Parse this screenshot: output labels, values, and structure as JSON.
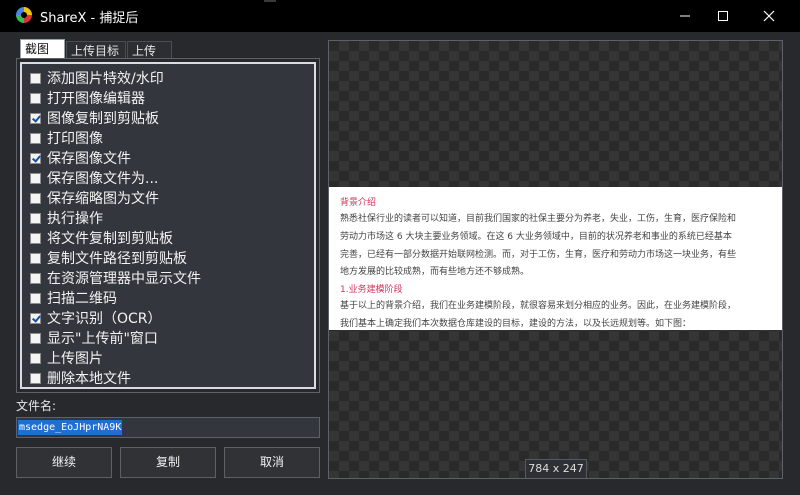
{
  "window": {
    "title": "ShareX - 捕捉后",
    "minimize_icon": "minimize-icon",
    "maximize_icon": "maximize-icon",
    "close_icon": "close-icon"
  },
  "tabs": [
    {
      "label": "截图后",
      "active": true
    },
    {
      "label": "上传目标",
      "active": false
    },
    {
      "label": "上传后",
      "active": false
    }
  ],
  "tasks": [
    {
      "label": "添加图片特效/水印",
      "checked": false
    },
    {
      "label": "打开图像编辑器",
      "checked": false
    },
    {
      "label": "图像复制到剪贴板",
      "checked": true
    },
    {
      "label": "打印图像",
      "checked": false
    },
    {
      "label": "保存图像文件",
      "checked": true
    },
    {
      "label": "保存图像文件为...",
      "checked": false
    },
    {
      "label": "保存缩略图为文件",
      "checked": false
    },
    {
      "label": "执行操作",
      "checked": false
    },
    {
      "label": "将文件复制到剪贴板",
      "checked": false
    },
    {
      "label": "复制文件路径到剪贴板",
      "checked": false
    },
    {
      "label": "在资源管理器中显示文件",
      "checked": false
    },
    {
      "label": "扫描二维码",
      "checked": false
    },
    {
      "label": "文字识别（OCR）",
      "checked": true
    },
    {
      "label": "显示\"上传前\"窗口",
      "checked": false
    },
    {
      "label": "上传图片",
      "checked": false
    },
    {
      "label": "删除本地文件",
      "checked": false
    }
  ],
  "filename": {
    "label": "文件名:",
    "value": "msedge_EoJHprNA9K"
  },
  "buttons": {
    "continue": "继续",
    "copy": "复制",
    "cancel": "取消"
  },
  "preview": {
    "dimensions": "784 x 247",
    "lines": [
      {
        "text": "背景介绍",
        "red": true
      },
      {
        "text": "熟悉社保行业的读者可以知道，目前我们国家的社保主要分为养老，失业，工伤，生育，医疗保险和",
        "red": false
      },
      {
        "text": "劳动力市场这 6 大块主要业务领域。在这 6 大业务领域中，目前的状况养老和事业的系统已经基本",
        "red": false
      },
      {
        "text": "完善，已经有一部分数据开始联网检测。而，对于工伤，生育，医疗和劳动力市场这一块业务，有些",
        "red": false
      },
      {
        "text": "地方发展的比较成熟，而有些地方还不够成熟。",
        "red": false
      },
      {
        "text": "1.业务建模阶段",
        "red": true
      },
      {
        "text": "基于以上的背景介绍，我们在业务建模阶段，就很容易来划分相应的业务。因此，在业务建模阶段，",
        "red": false
      },
      {
        "text": "我们基本上确定我们本次数据仓库建设的目标，建设的方法，以及长远规划等。如下图：",
        "red": false
      }
    ]
  },
  "colors": {
    "titlebar": "#000000",
    "background": "#27292d",
    "selection": "#1f6fd1",
    "accent_red": "#d2345c"
  }
}
